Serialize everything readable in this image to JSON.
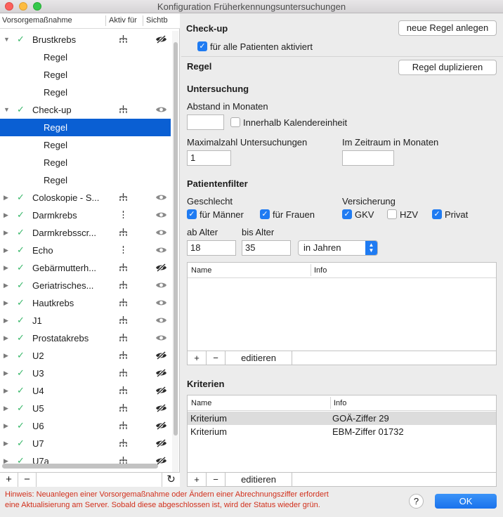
{
  "window": {
    "title": "Konfiguration Früherkennungsuntersuchungen"
  },
  "list": {
    "columns": [
      "Vorsorgemaßnahme",
      "Aktiv für",
      "Sichtb"
    ],
    "rows": [
      {
        "label": "Brustkrebs",
        "expanded": true,
        "vis": "hidden"
      },
      {
        "label": "Regel",
        "child": true
      },
      {
        "label": "Regel",
        "child": true
      },
      {
        "label": "Regel",
        "child": true
      },
      {
        "label": "Check-up",
        "expanded": true,
        "vis": "visible"
      },
      {
        "label": "Regel",
        "child": true,
        "selected": true
      },
      {
        "label": "Regel",
        "child": true
      },
      {
        "label": "Regel",
        "child": true
      },
      {
        "label": "Regel",
        "child": true
      },
      {
        "label": "Coloskopie - S...",
        "vis": "visible"
      },
      {
        "label": "Darmkrebs",
        "vis": "visible",
        "single": true
      },
      {
        "label": "Darmkrebsscr...",
        "vis": "visible"
      },
      {
        "label": "Echo",
        "vis": "visible",
        "single": true
      },
      {
        "label": "Gebärmutterh...",
        "vis": "hidden"
      },
      {
        "label": "Geriatrisches...",
        "vis": "visible"
      },
      {
        "label": "Hautkrebs",
        "vis": "visible"
      },
      {
        "label": "J1",
        "vis": "visible"
      },
      {
        "label": "Prostatakrebs",
        "vis": "visible"
      },
      {
        "label": "U2",
        "vis": "hidden"
      },
      {
        "label": "U3",
        "vis": "hidden"
      },
      {
        "label": "U4",
        "vis": "hidden"
      },
      {
        "label": "U5",
        "vis": "hidden"
      },
      {
        "label": "U6",
        "vis": "hidden"
      },
      {
        "label": "U7",
        "vis": "hidden"
      },
      {
        "label": "U7a",
        "vis": "hidden"
      }
    ],
    "add": "+",
    "remove": "−",
    "refresh": "↻"
  },
  "checkup": {
    "title": "Check-up",
    "new_rule_button": "neue Regel anlegen",
    "all_patients_label": "für alle Patienten aktiviert",
    "all_patients_checked": true
  },
  "rule": {
    "title": "Regel",
    "duplicate_button": "Regel duplizieren"
  },
  "exam": {
    "title": "Untersuchung",
    "interval_label": "Abstand in Monaten",
    "interval_value": "",
    "calendar_label": "Innerhalb Kalendereinheit",
    "calendar_checked": false,
    "max_label": "Maximalzahl Untersuchungen",
    "max_value": "1",
    "period_label": "Im Zeitraum in Monaten",
    "period_value": ""
  },
  "filter": {
    "title": "Patientenfilter",
    "gender_label": "Geschlecht",
    "male_label": "für Männer",
    "male_checked": true,
    "female_label": "für Frauen",
    "female_checked": true,
    "insurance_label": "Versicherung",
    "gkv_label": "GKV",
    "gkv_checked": true,
    "hzv_label": "HZV",
    "hzv_checked": false,
    "privat_label": "Privat",
    "privat_checked": true,
    "age_from_label": "ab Alter",
    "age_from": "18",
    "age_to_label": "bis Alter",
    "age_to": "35",
    "unit": "in Jahren"
  },
  "table1": {
    "col_name": "Name",
    "col_info": "Info",
    "edit_label": "editieren",
    "add": "+",
    "remove": "−"
  },
  "criteria": {
    "title": "Kriterien",
    "col_name": "Name",
    "col_info": "Info",
    "rows": [
      {
        "name": "Kriterium",
        "info": "GOÄ-Ziffer 29"
      },
      {
        "name": "Kriterium",
        "info": "EBM-Ziffer 01732"
      }
    ],
    "edit_label": "editieren",
    "add": "+",
    "remove": "−"
  },
  "footer": {
    "hint_line1": "Hinweis: Neuanlegen einer Vorsorgemaßnahme oder Ändern einer Abrechnungsziffer erfordert",
    "hint_line2": "eine Aktualisierung am Server. Sobald diese abgeschlossen ist, wird der Status wieder grün.",
    "help_label": "?",
    "ok_label": "OK"
  }
}
